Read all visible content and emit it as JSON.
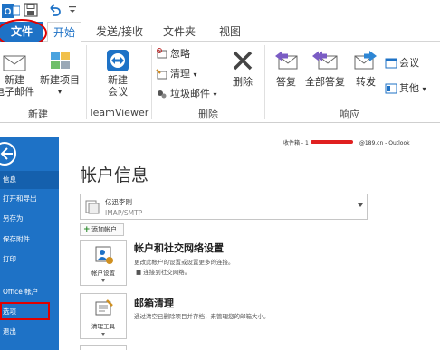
{
  "quick_access": {
    "icons": [
      "outlook-app-icon",
      "save-icon",
      "undo-icon",
      "customize-icon"
    ]
  },
  "tabs": {
    "file": "文件",
    "start": "开始",
    "send_receive": "发送/接收",
    "folder": "文件夹",
    "view": "视图"
  },
  "ribbon": {
    "new_email": "新建\n电子邮件",
    "new_email_line1": "新建",
    "new_email_line2": "电子邮件",
    "new_items_line1": "新建项目",
    "new_group": "新建",
    "teamviewer_line1": "新建",
    "teamviewer_line2": "会议",
    "teamviewer_group": "TeamViewer",
    "ignore": "忽略",
    "cleanup": "清理",
    "junk": "垃圾邮件",
    "delete": "删除",
    "delete_group": "删除",
    "reply": "答复",
    "reply_all": "全部答复",
    "forward": "转发",
    "meeting": "会议",
    "more": "其他",
    "respond_group": "响应"
  },
  "backstage": {
    "nav": {
      "info": "信息",
      "open_export": "打开和导出",
      "save_as": "另存为",
      "save_attachments": "保存附件",
      "print": "打印",
      "office_account": "Office 帐户",
      "options": "选项",
      "exit": "退出"
    },
    "account_strip_prefix": "收件箱 - 1",
    "account_strip_suffix": "@189.cn - Outlook",
    "page_title": "帐户信息",
    "account_name": "亿迅李刚",
    "account_type": "IMAP/SMTP",
    "add_account": "添加帐户",
    "settings_tile": "帐户设置",
    "settings_title": "帐户和社交网络设置",
    "settings_desc": "更改此帐户的设置或设置更多的连接。",
    "settings_bullet": "连接到社交网络。",
    "cleanup_tile": "清理工具",
    "cleanup_title": "邮箱清理",
    "cleanup_desc": "通过清空已删除项目并存档，来管理您的邮箱大小。"
  },
  "colors": {
    "accent_blue": "#1e72c6",
    "annotation_red": "#e00000"
  }
}
